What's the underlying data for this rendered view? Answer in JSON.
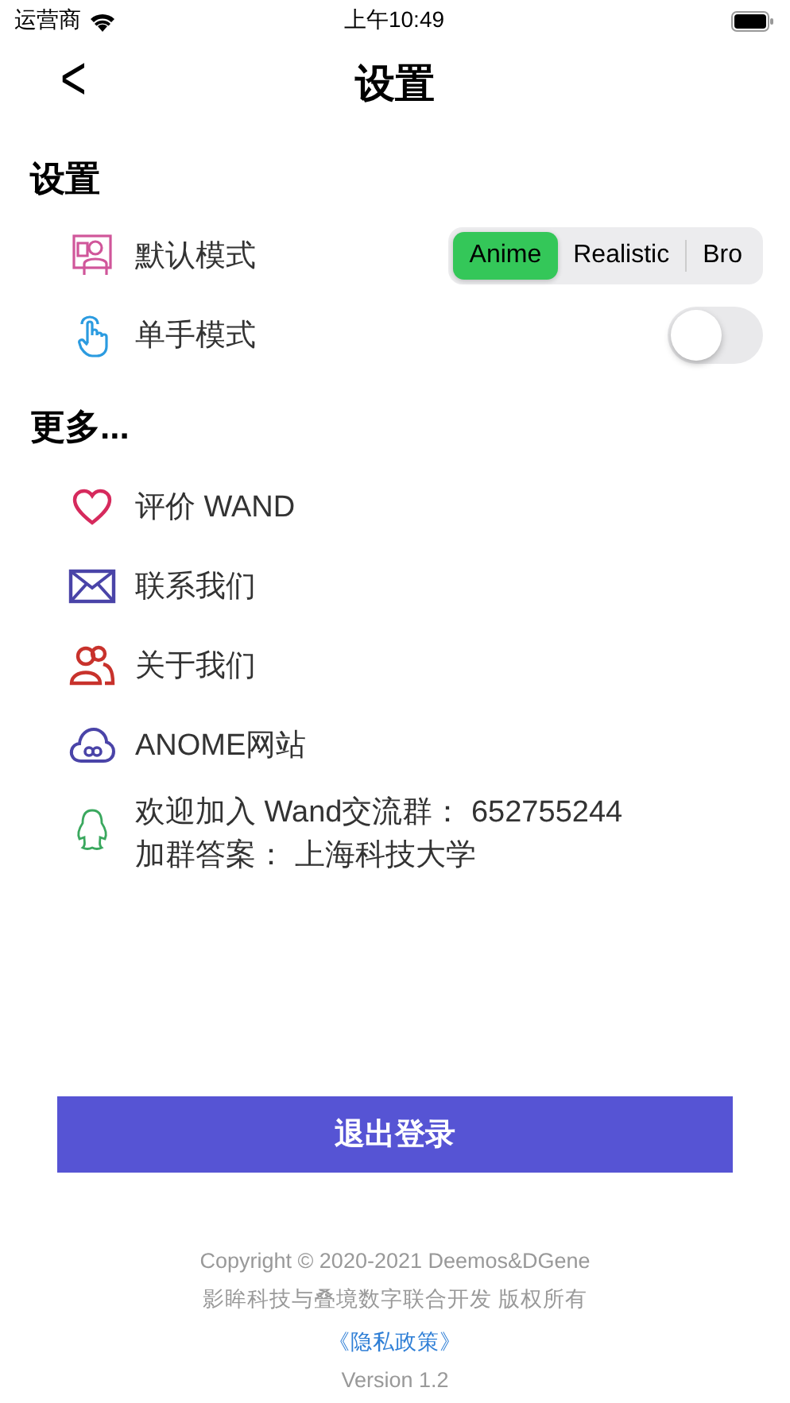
{
  "status_bar": {
    "carrier": "运营商",
    "time": "上午10:49"
  },
  "nav": {
    "back": "<",
    "title": "设置"
  },
  "settings": {
    "heading": "设置",
    "rows": [
      {
        "kind": "segmented",
        "label": "默认模式",
        "options": [
          {
            "label": "Anime",
            "selected": true
          },
          {
            "label": "Realistic",
            "selected": false
          },
          {
            "label": "Bro",
            "selected": false
          }
        ]
      },
      {
        "kind": "toggle",
        "label": "单手模式",
        "on": false
      }
    ]
  },
  "more": {
    "heading": "更多...",
    "items": [
      {
        "lines": [
          "评价 WAND"
        ]
      },
      {
        "lines": [
          "联系我们"
        ]
      },
      {
        "lines": [
          "关于我们"
        ]
      },
      {
        "lines": [
          "ANOME网站"
        ]
      },
      {
        "lines": [
          "欢迎加入 Wand交流群： 652755244",
          "加群答案： 上海科技大学"
        ]
      }
    ]
  },
  "logout_button": "退出登录",
  "footer": {
    "copyright": "Copyright © 2020-2021 Deemos&DGene",
    "credits": "影眸科技与叠境数字联合开发 版权所有",
    "privacy_link": "《隐私政策》",
    "version": "Version 1.2"
  }
}
